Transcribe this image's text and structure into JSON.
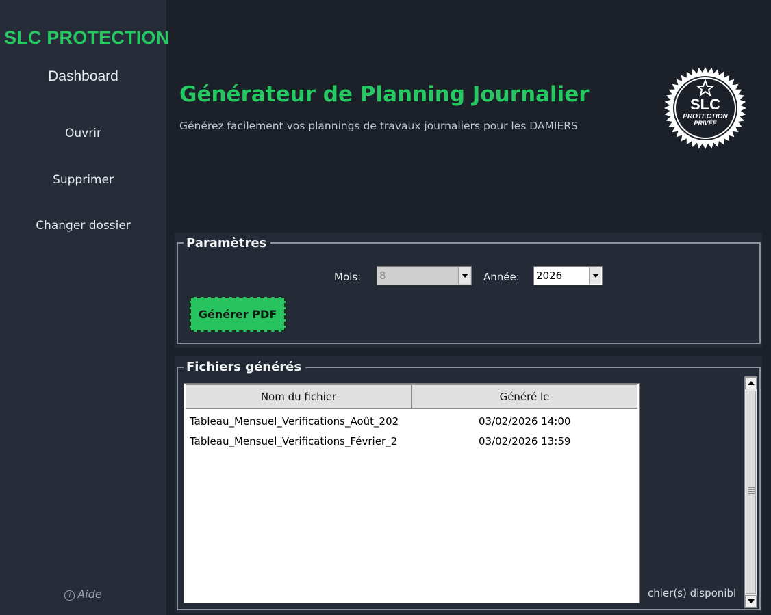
{
  "sidebar": {
    "brand": "SLC PROTECTION",
    "dashboard": "Dashboard",
    "items": [
      {
        "label": "Ouvrir"
      },
      {
        "label": "Supprimer"
      },
      {
        "label": "Changer dossier"
      }
    ],
    "help": {
      "icon": "info-icon",
      "label": "Aide"
    }
  },
  "header": {
    "title": "Générateur de Planning Journalier",
    "subtitle": "Générez facilement vos plannings de travaux journaliers pour les DAMIERS",
    "logo": {
      "line1": "SLC",
      "line2": "PROTECTION",
      "line3": "PRIVÉE"
    }
  },
  "params": {
    "legend": "Paramètres",
    "month_label": "Mois:",
    "month_value": "8",
    "year_label": "Année:",
    "year_value": "2026",
    "generate_label": "Générer PDF"
  },
  "files": {
    "legend": "Fichiers générés",
    "columns": [
      "Nom du fichier",
      "Généré le"
    ],
    "rows": [
      {
        "name": "Tableau_Mensuel_Verifications_Août_202",
        "date": "03/02/2026 14:00"
      },
      {
        "name": "Tableau_Mensuel_Verifications_Février_2",
        "date": "03/02/2026 13:59"
      }
    ],
    "status": "chier(s) disponibl"
  },
  "colors": {
    "accent": "#27c862",
    "background": "#1b2029",
    "sidebar": "#262d38"
  }
}
